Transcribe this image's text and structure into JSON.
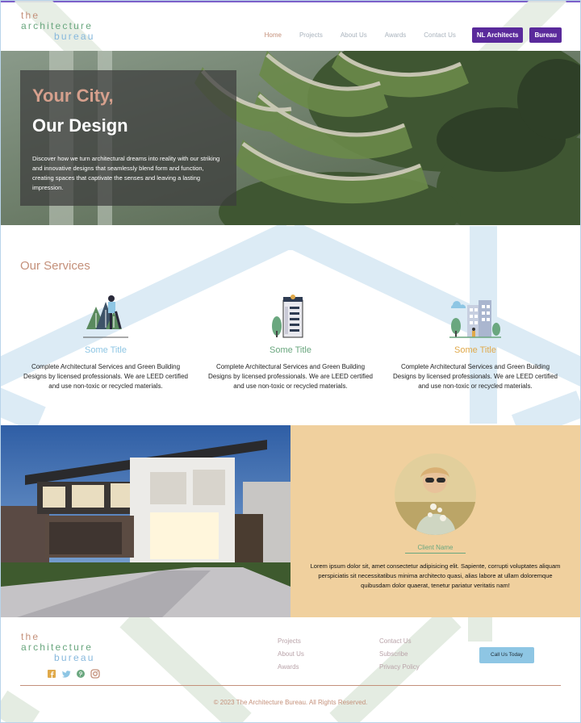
{
  "logo": {
    "line1": "the",
    "line2": "architecture",
    "line3": "bureau"
  },
  "nav": {
    "links": [
      "Home",
      "Projects",
      "About Us",
      "Awards",
      "Contact Us"
    ],
    "active": "Home",
    "buttons": [
      "NL Architects",
      "Bureau"
    ]
  },
  "hero": {
    "title_line1": "Your City,",
    "title_line2": "Our Design",
    "text": "Discover how we turn architectural dreams into reality with our striking and innovative designs that seamlessly blend form and function, creating spaces that captivate the senses and leaving a lasting impression."
  },
  "services": {
    "heading": "Our Services",
    "items": [
      {
        "title": "Some Title",
        "color": "#8ec6e4",
        "text": "Complete Architectural Services and Green Building Designs by licensed professionals. We are LEED certified and use non-toxic or recycled materials."
      },
      {
        "title": "Some Title",
        "color": "#6aa77f",
        "text": "Complete Architectural Services and Green Building Designs by licensed professionals. We are LEED certified and use non-toxic or recycled materials."
      },
      {
        "title": "Some Title",
        "color": "#e0a94a",
        "text": "Complete Architectural Services and Green Building Designs by licensed professionals. We are LEED certified and use non-toxic or recycled materials."
      }
    ]
  },
  "testimonial": {
    "client_name": "Client Name",
    "quote": "Lorem ipsum dolor sit, amet consectetur adipisicing elit. Sapiente, corrupti voluptates aliquam perspiciatis sit necessitatibus minima architecto quasi, alias labore at ullam doloremque quibusdam dolor quaerat, tenetur pariatur veritatis nam!"
  },
  "footer": {
    "col1": [
      "Projects",
      "About Us",
      "Awards"
    ],
    "col2": [
      "Contact Us",
      "Subscribe",
      "Privacy Policy"
    ],
    "cta": "Call Us Today",
    "social_icons": [
      "facebook-icon",
      "twitter-icon",
      "pinterest-icon",
      "instagram-icon"
    ],
    "copyright": "© 2023 The Architecture Bureau. All Rights Reserved."
  },
  "colors": {
    "accent_rose": "#c4907a",
    "accent_green": "#6aa77f",
    "accent_blue": "#86b8dd",
    "nav_button": "#5a2a9b",
    "testimonial_bg": "#f0d09e",
    "top_bar": "#7b5fc9"
  }
}
